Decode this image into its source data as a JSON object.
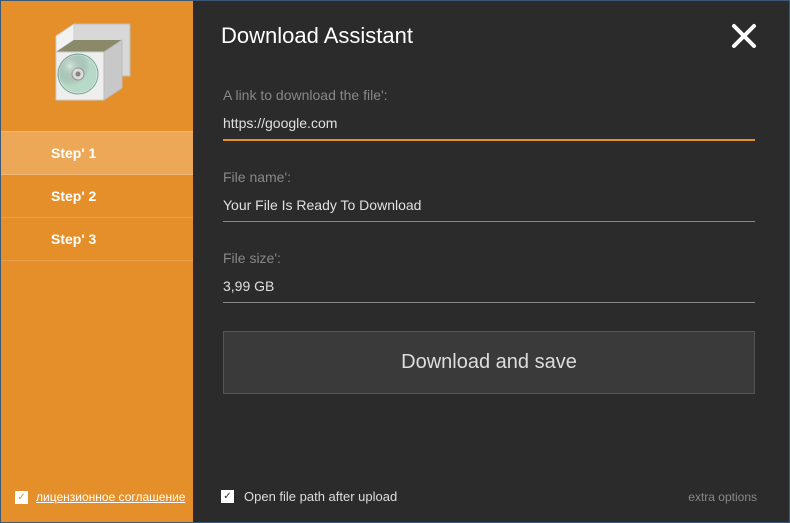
{
  "header": {
    "title": "Download Assistant"
  },
  "sidebar": {
    "steps": [
      {
        "label": "Step' 1",
        "active": true
      },
      {
        "label": "Step' 2",
        "active": false
      },
      {
        "label": "Step' 3",
        "active": false
      }
    ],
    "license": {
      "checked": true,
      "label": "лицензионное соглашение"
    }
  },
  "form": {
    "link": {
      "label": "A link to download the file':",
      "value": "https://google.com"
    },
    "filename": {
      "label": "File name':",
      "value": "Your File Is Ready To Download"
    },
    "filesize": {
      "label": "File size':",
      "value": "3,99 GB"
    },
    "download_button": "Download and save"
  },
  "footer": {
    "open_path": {
      "checked": true,
      "label": "Open file path after upload"
    },
    "extra_options": "extra options"
  }
}
